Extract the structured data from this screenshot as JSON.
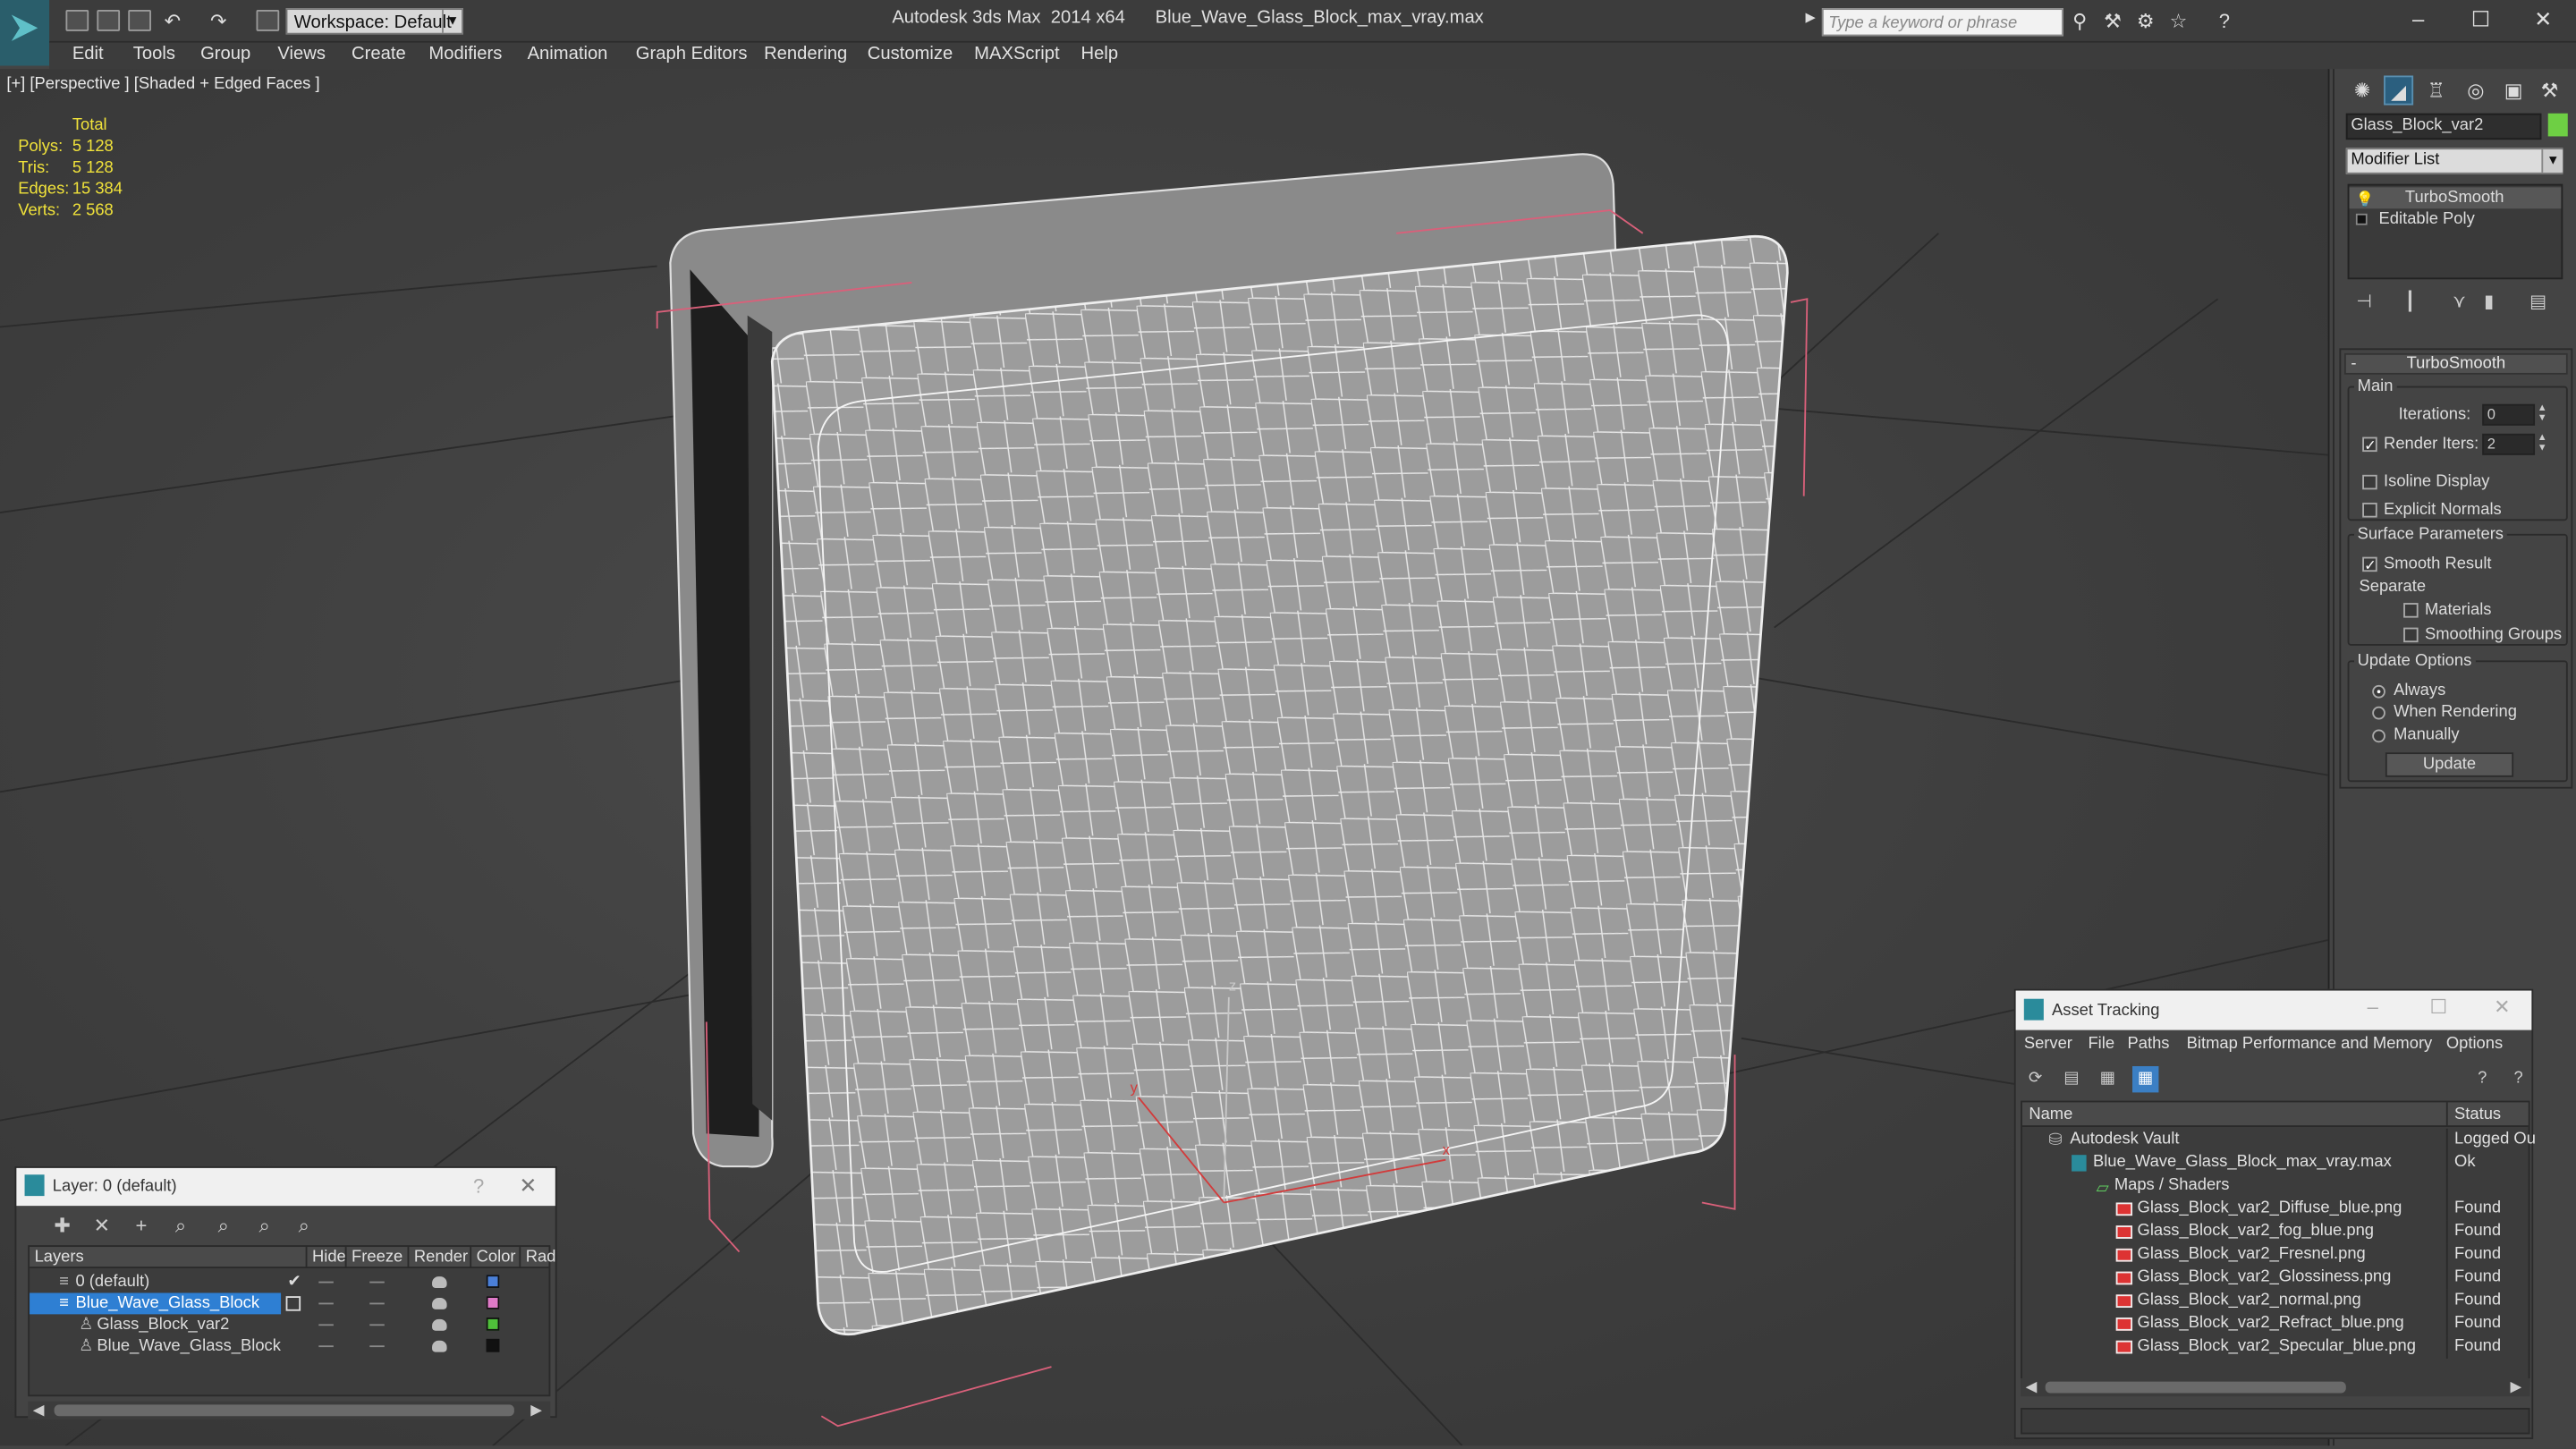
{
  "window": {
    "app_title": "Autodesk 3ds Max  2014 x64",
    "file_title": "Blue_Wave_Glass_Block_max_vray.max",
    "workspace": "Workspace: Default",
    "search_placeholder": "Type a keyword or phrase"
  },
  "menu": [
    "Edit",
    "Tools",
    "Group",
    "Views",
    "Create",
    "Modifiers",
    "Animation",
    "Graph Editors",
    "Rendering",
    "Customize",
    "MAXScript",
    "Help"
  ],
  "viewport": {
    "label": "[+] [Perspective ] [Shaded + Edged Faces ]",
    "stats": {
      "header": "Total",
      "rows": [
        {
          "k": "Polys:",
          "v": "5 128"
        },
        {
          "k": "Tris:",
          "v": "5 128"
        },
        {
          "k": "Edges:",
          "v": "15 384"
        },
        {
          "k": "Verts:",
          "v": "2 568"
        }
      ]
    },
    "axis": {
      "z": "z",
      "y": "y",
      "x": "x"
    }
  },
  "command_panel": {
    "object_name": "Glass_Block_var2",
    "object_color": "#6ecf44",
    "modifier_list": "Modifier List",
    "stack": [
      "TurboSmooth",
      "Editable Poly"
    ],
    "rollout_title": "TurboSmooth",
    "main_group": "Main",
    "iterations_label": "Iterations:",
    "iterations_value": "0",
    "render_iters_label": "Render Iters:",
    "render_iters_value": "2",
    "isoline": "Isoline Display",
    "explicit_normals": "Explicit Normals",
    "surface_group": "Surface Parameters",
    "smooth_result": "Smooth Result",
    "separate": "Separate",
    "materials": "Materials",
    "smoothing_groups": "Smoothing Groups",
    "update_group": "Update Options",
    "always": "Always",
    "when_rendering": "When Rendering",
    "manually": "Manually",
    "update_button": "Update"
  },
  "layers": {
    "title": "Layer: 0 (default)",
    "columns": [
      "Layers",
      "Hide",
      "Freeze",
      "Render",
      "Color",
      "Rad"
    ],
    "rows": [
      {
        "name": "0 (default)",
        "color": "#4a7fd8"
      },
      {
        "name": "Blue_Wave_Glass_Block",
        "color": "#e07ac8"
      },
      {
        "name": "Glass_Block_var2",
        "color": "#4fbf3a"
      },
      {
        "name": "Blue_Wave_Glass_Block",
        "color": "#111111"
      }
    ]
  },
  "asset_tracking": {
    "title": "Asset Tracking",
    "menu": [
      "Server",
      "File",
      "Paths",
      "Bitmap Performance and Memory",
      "Options"
    ],
    "columns": [
      "Name",
      "Status"
    ],
    "rows": [
      {
        "name": "Autodesk Vault",
        "status": "Logged Ou"
      },
      {
        "name": "Blue_Wave_Glass_Block_max_vray.max",
        "status": "Ok"
      },
      {
        "name": "Maps / Shaders",
        "status": ""
      },
      {
        "name": "Glass_Block_var2_Diffuse_blue.png",
        "status": "Found"
      },
      {
        "name": "Glass_Block_var2_fog_blue.png",
        "status": "Found"
      },
      {
        "name": "Glass_Block_var2_Fresnel.png",
        "status": "Found"
      },
      {
        "name": "Glass_Block_var2_Glossiness.png",
        "status": "Found"
      },
      {
        "name": "Glass_Block_var2_normal.png",
        "status": "Found"
      },
      {
        "name": "Glass_Block_var2_Refract_blue.png",
        "status": "Found"
      },
      {
        "name": "Glass_Block_var2_Specular_blue.png",
        "status": "Found"
      }
    ]
  }
}
